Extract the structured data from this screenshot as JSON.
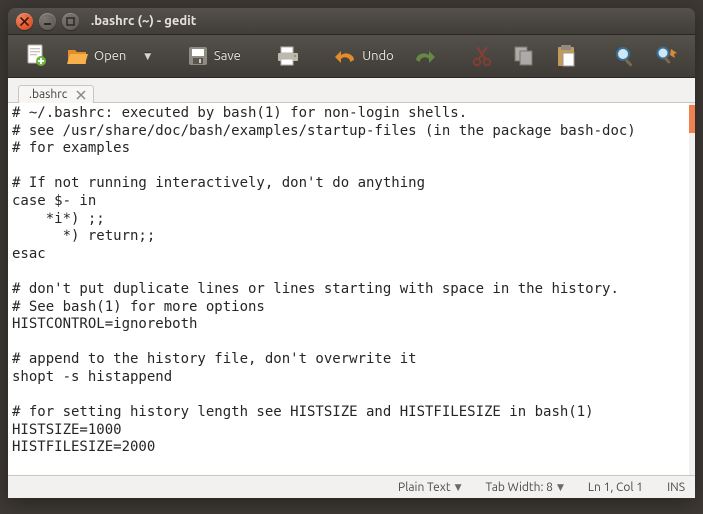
{
  "window": {
    "title": ".bashrc (~) - gedit"
  },
  "toolbar": {
    "open_label": "Open",
    "save_label": "Save",
    "undo_label": "Undo"
  },
  "tab": {
    "name": ".bashrc"
  },
  "editor": {
    "content": "# ~/.bashrc: executed by bash(1) for non-login shells.\n# see /usr/share/doc/bash/examples/startup-files (in the package bash-doc)\n# for examples\n\n# If not running interactively, don't do anything\ncase $- in\n    *i*) ;;\n      *) return;;\nesac\n\n# don't put duplicate lines or lines starting with space in the history.\n# See bash(1) for more options\nHISTCONTROL=ignoreboth\n\n# append to the history file, don't overwrite it\nshopt -s histappend\n\n# for setting history length see HISTSIZE and HISTFILESIZE in bash(1)\nHISTSIZE=1000\nHISTFILESIZE=2000"
  },
  "status": {
    "syntax": "Plain Text",
    "tabwidth": "Tab Width: 8",
    "position": "Ln 1, Col 1",
    "insert": "INS"
  }
}
